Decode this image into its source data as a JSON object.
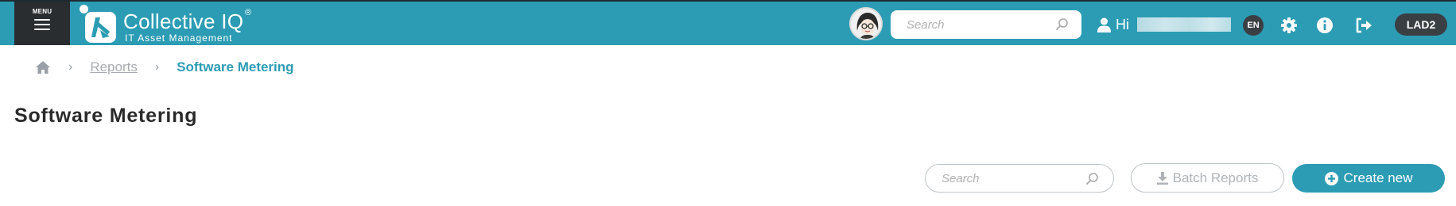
{
  "header": {
    "menu_label": "MENU",
    "brand_name": "Collective IQ",
    "brand_registered": "®",
    "brand_tagline": "IT Asset Management",
    "search_placeholder": "Search",
    "greeting": "Hi",
    "language": "EN",
    "environment": "LAD2",
    "icons": [
      "hamburger-icon",
      "search-icon",
      "user-icon",
      "gear-icon",
      "info-icon",
      "logout-icon"
    ]
  },
  "breadcrumb": {
    "home_icon": "home-icon",
    "separator": "›",
    "items": [
      {
        "label": "Reports"
      },
      {
        "label": "Software Metering"
      }
    ]
  },
  "page": {
    "title": "Software Metering"
  },
  "toolbar": {
    "search_placeholder": "Search",
    "batch_reports_label": "Batch Reports",
    "create_new_label": "Create new"
  },
  "colors": {
    "topbar": "#2c9cb4",
    "menu_bg": "#2a2d30",
    "accent": "#2c9cb4",
    "badge_bg": "#3a3f44",
    "muted": "#a8acb0"
  }
}
